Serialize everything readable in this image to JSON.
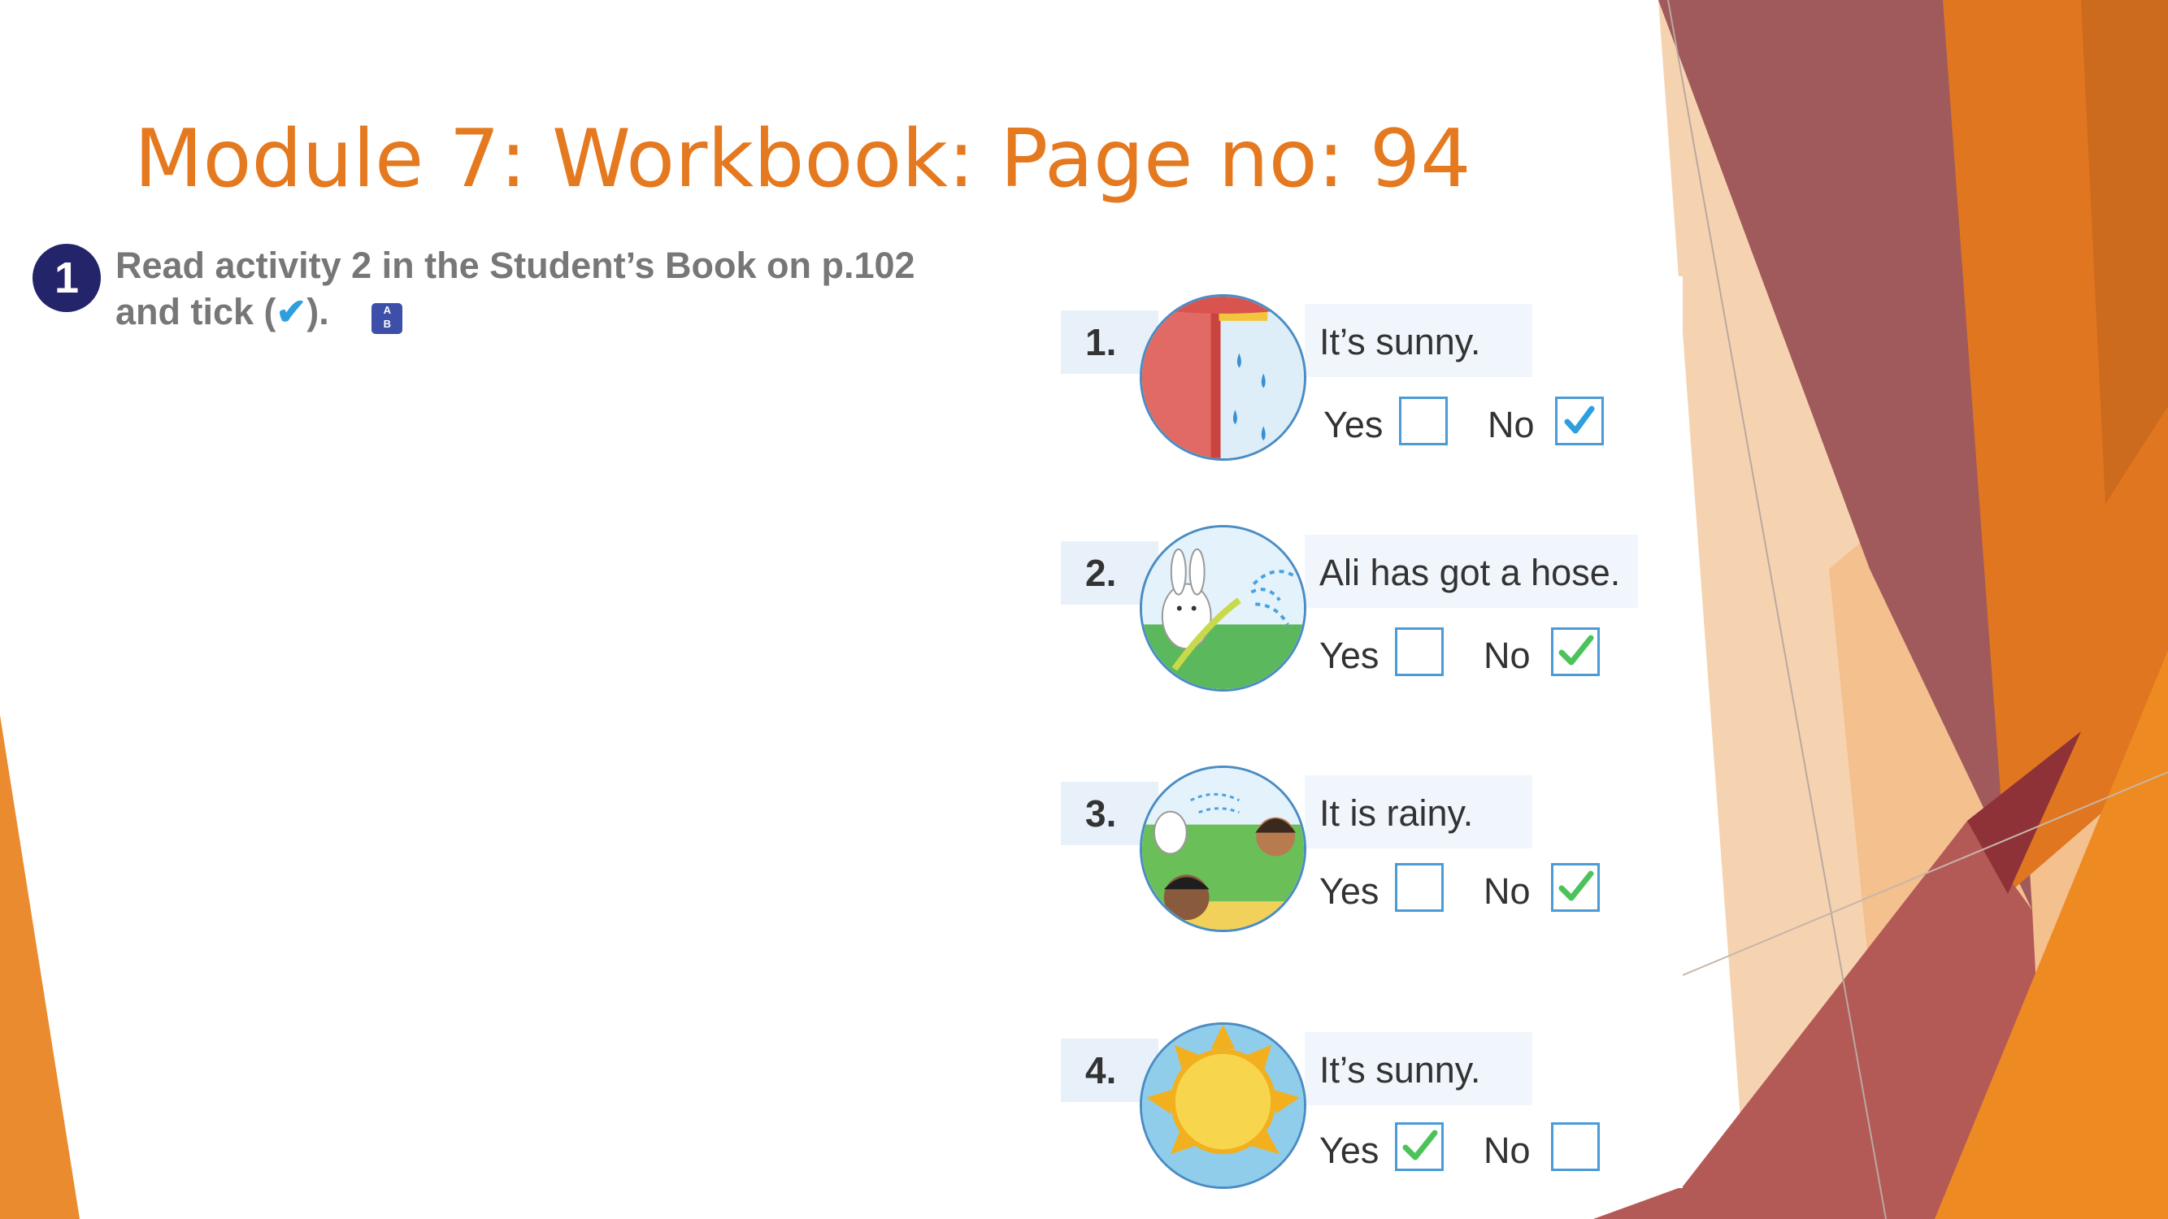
{
  "slide": {
    "title": "Module 7: Workbook: Page no: 94",
    "colors": {
      "title": "#E5791F",
      "badge": "#23246A",
      "box_border": "#4A9BD6",
      "tick_blue": "#2E9FDE",
      "tick_green": "#4CC35A",
      "facet_orange": "#E98B2E",
      "facet_red": "#A8484A",
      "facet_peach": "#F6D3B0"
    }
  },
  "activity": {
    "number": "1",
    "instruction_line1": "Read activity 2 in the Student’s Book on p.102",
    "instruction_line2_start": "and tick (",
    "tick_symbol": "✔",
    "instruction_line2_end": ").",
    "ab_icon_top": "A",
    "ab_icon_bottom": "B"
  },
  "items": [
    {
      "number": "1.",
      "sentence": "It’s sunny.",
      "yes_label": "Yes",
      "no_label": "No",
      "ticked": "No",
      "tick_color": "blue",
      "picture_icon": "rain-window-icon"
    },
    {
      "number": "2.",
      "sentence": "Ali has got a hose.",
      "yes_label": "Yes",
      "no_label": "No",
      "ticked": "No",
      "tick_color": "green",
      "picture_icon": "rabbit-hose-icon"
    },
    {
      "number": "3.",
      "sentence": "It is rainy.",
      "yes_label": "Yes",
      "no_label": "No",
      "ticked": "No",
      "tick_color": "green",
      "picture_icon": "children-garden-icon"
    },
    {
      "number": "4.",
      "sentence": "It’s sunny.",
      "yes_label": "Yes",
      "no_label": "No",
      "ticked": "Yes",
      "tick_color": "green",
      "picture_icon": "sun-icon"
    }
  ]
}
